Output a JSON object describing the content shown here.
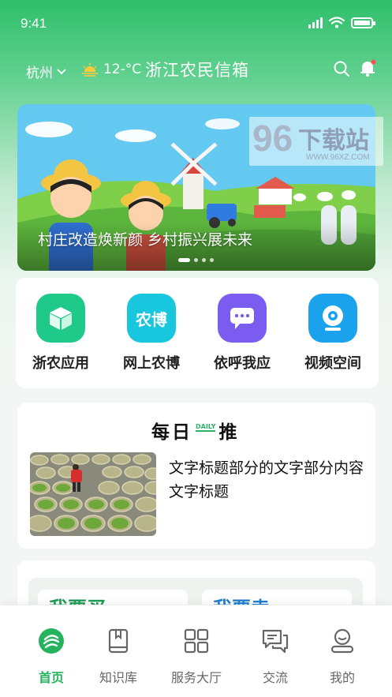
{
  "status_bar": {
    "time": "9:41"
  },
  "header": {
    "city": "杭州",
    "temperature": "12-°C",
    "title": "浙江农民信箱"
  },
  "banner": {
    "caption": "村庄改造焕新颜 乡村振兴展未来",
    "slide_count": 4,
    "active_slide": 1
  },
  "watermark": {
    "number": "96",
    "text": "下载站",
    "url": "WWW.96XZ.COM"
  },
  "quick_actions": [
    {
      "label": "浙农应用",
      "icon": "cube-icon",
      "color": "#1ec98a"
    },
    {
      "label": "网上农博",
      "icon": "nongbo-icon",
      "icon_text": "农博",
      "color": "#18c6dd"
    },
    {
      "label": "依呼我应",
      "icon": "chat-icon",
      "color": "#7b5cf0"
    },
    {
      "label": "视频空间",
      "icon": "webcam-icon",
      "color": "#1aa3ec"
    }
  ],
  "daily": {
    "title_left": "每日",
    "tag": "DAILY",
    "title_right": "推",
    "article_title": "文字标题部分的文字部分内容文字标题"
  },
  "more": {
    "tiles": [
      {
        "label": "我要买",
        "color": "#1f9e55"
      },
      {
        "label": "我要卖",
        "color": "#1f7fd0"
      }
    ]
  },
  "tabbar": {
    "items": [
      {
        "label": "首页",
        "icon": "home-icon",
        "active": true
      },
      {
        "label": "知识库",
        "icon": "book-icon",
        "active": false
      },
      {
        "label": "服务大厅",
        "icon": "grid-icon",
        "active": false
      },
      {
        "label": "交流",
        "icon": "chat-bubbles-icon",
        "active": false
      },
      {
        "label": "我的",
        "icon": "profile-icon",
        "active": false
      }
    ]
  },
  "colors": {
    "primary": "#26b35e",
    "header_green": "#2fbf6b"
  }
}
